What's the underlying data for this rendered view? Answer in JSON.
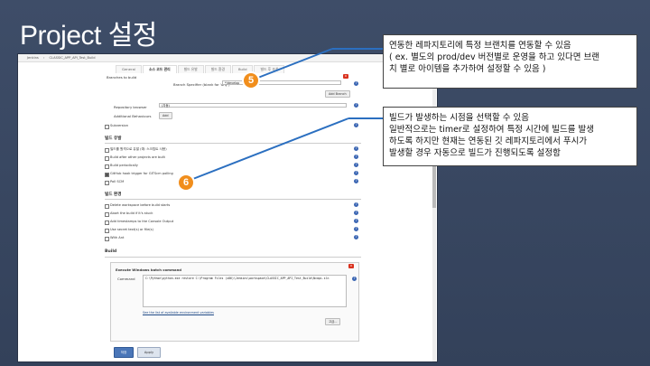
{
  "slide": {
    "title": "Project 설정"
  },
  "breadcrumb": [
    "Jenkins",
    "CLASSIC_APP_API_Test_Build"
  ],
  "tabs": [
    "General",
    "소스 코드 관리",
    "빌드 유발",
    "빌드 환경",
    "Build",
    "빌드 후 조치"
  ],
  "scm": {
    "branches_label": "Branches to build",
    "branch_specifier_label": "Branch Specifier (blank for 'any')",
    "branch_specifier_value": "*/develop",
    "add_branch_label": "Add Branch",
    "repo_browser_label": "Repository browser",
    "repo_browser_value": "(자동)",
    "additional_behaviours_label": "Additional Behaviours",
    "add_label": "Add",
    "subversion_label": "Subversion"
  },
  "triggers": {
    "heading": "빌드 유발",
    "items": [
      {
        "label": "빌드를 원격으로 유발 (예: 스크립트 사용)",
        "checked": false
      },
      {
        "label": "Build after other projects are built",
        "checked": false
      },
      {
        "label": "Build periodically",
        "checked": false
      },
      {
        "label": "GitHub hook trigger for GITScm polling",
        "checked": true
      },
      {
        "label": "Poll SCM",
        "checked": false
      }
    ]
  },
  "env": {
    "heading": "빌드 환경",
    "items": [
      {
        "label": "Delete workspace before build starts"
      },
      {
        "label": "Abort the build if it's stuck"
      },
      {
        "label": "Add timestamps to the Console Output"
      },
      {
        "label": "Use secret text(s) or file(s)"
      },
      {
        "label": "With Ant"
      }
    ]
  },
  "build": {
    "heading": "Build",
    "step_title": "Execute Windows batch command",
    "command_label": "Command",
    "command_value": "C:\\Python\\python.exe restore C:\\Program Files (x86)\\Jenkins\\workspace\\CLASSIC_APP_API_Test_Build\\Ncapi.sln",
    "env_link": "See the list of available environment variables",
    "advanced_label": "고급..."
  },
  "buttons": {
    "save": "저장",
    "apply": "Apply"
  },
  "markers": [
    "5",
    "6"
  ],
  "callouts": {
    "c5": [
      "연동한 레파지토리에 특정 브랜치를 연동할 수 있음",
      "( ex. 별도의 prod/dev 버전별로 운영을 하고 있다면 브랜",
      "치 별로 아이템을 추가하여 설정할 수 있음 )"
    ],
    "c6": [
      "빌드가 발생하는 시점을 선택할 수 있음",
      "일반적으로는 timer로 설정하여 특정 시간에 빌드를 발생",
      "하도록 하지만 현재는 연동된 깃 레파지토리에서 푸시가",
      "발생할 경우 자동으로 빌드가 진행되도록 설정함"
    ]
  },
  "colors": {
    "background": "#3e4d68",
    "marker": "#f18e1c",
    "connector": "#2b6fc0",
    "save_button": "#4a76b8"
  }
}
